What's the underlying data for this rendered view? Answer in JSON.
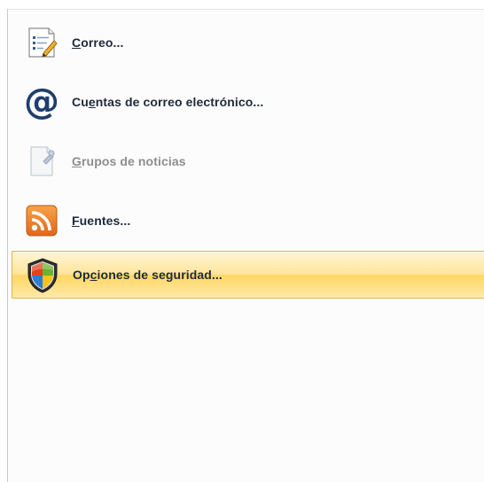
{
  "menu": {
    "items": [
      {
        "label_pre": "",
        "label_key": "C",
        "label_post": "orreo...",
        "icon": "mail-document-icon",
        "enabled": true
      },
      {
        "label_pre": "Cu",
        "label_key": "e",
        "label_post": "ntas de correo electrónico...",
        "icon": "at-sign-icon",
        "enabled": true
      },
      {
        "label_pre": "",
        "label_key": "G",
        "label_post": "rupos de noticias",
        "icon": "newsgroup-icon",
        "enabled": false
      },
      {
        "label_pre": "",
        "label_key": "F",
        "label_post": "uentes...",
        "icon": "rss-feed-icon",
        "enabled": true
      },
      {
        "label_pre": "Op",
        "label_key": "c",
        "label_post": "iones de seguridad...",
        "icon": "security-shield-icon",
        "enabled": true,
        "highlighted": true
      }
    ]
  }
}
